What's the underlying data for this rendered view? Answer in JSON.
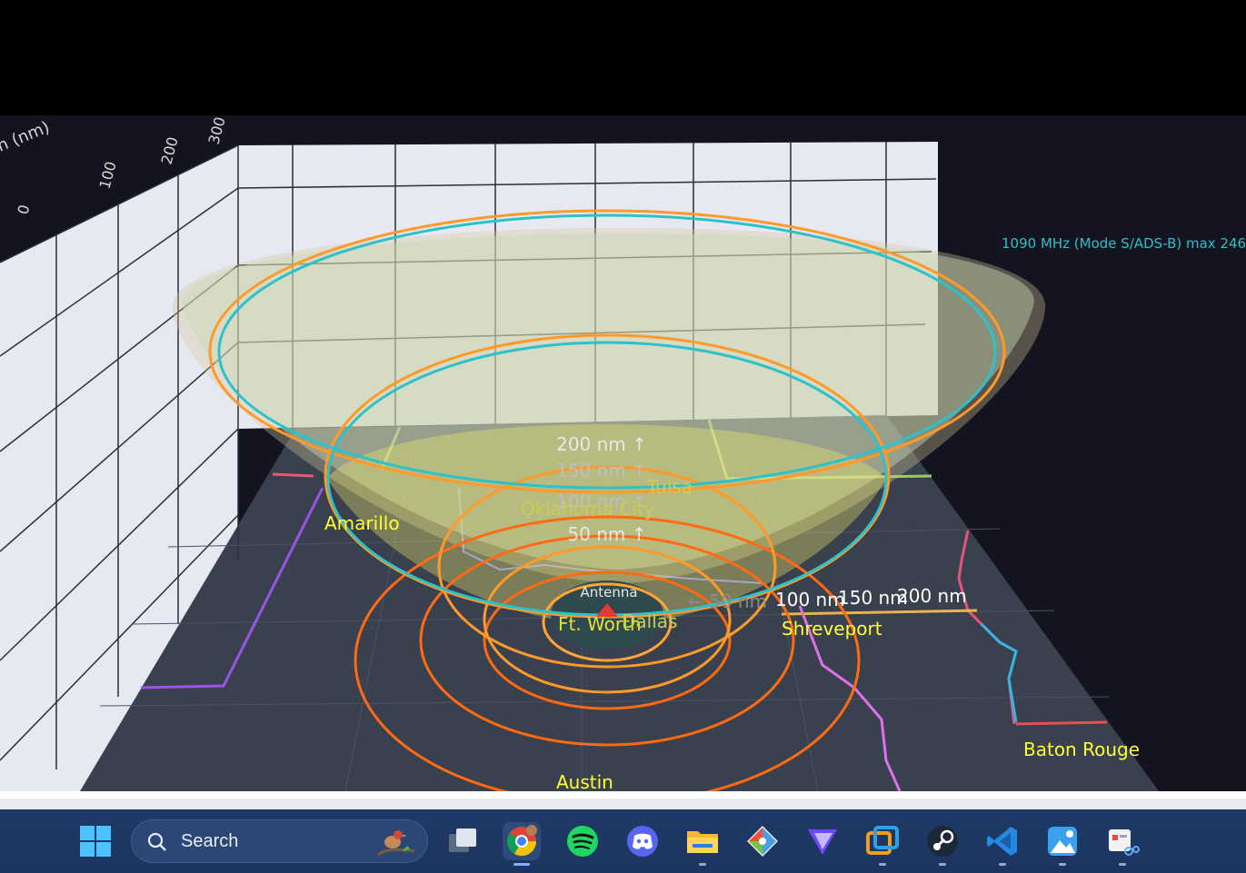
{
  "plot": {
    "axis_title": "n (nm)",
    "axis_ticks": [
      "0",
      "100",
      "200",
      "300"
    ],
    "legend_text": "1090 MHz (Mode S/ADS-B) max 246",
    "antenna_label": "Antenna",
    "range_labels_vertical": [
      "200 nm ↑",
      "150 nm ↑",
      "100 nm ↑",
      "50 nm ↑"
    ],
    "range_labels_horizontal": [
      "← 50 nm",
      "100 nm",
      "150 nm",
      "200 nm"
    ],
    "cities": {
      "amarillo": "Amarillo",
      "oklahoma_city": "Oklahoma City",
      "tulsa": "Tulsa",
      "ft_worth": "Ft. Worth",
      "dallas": "Dallas",
      "shreveport": "Shreveport",
      "baton_rouge": "Baton Rouge",
      "austin": "Austin"
    },
    "colors": {
      "range_ring": "#ff7a1a",
      "coverage_ring": "#2fc1c8",
      "city_label": "#ffff33",
      "legend": "#2fc1c8"
    }
  },
  "taskbar": {
    "search_placeholder": "Search",
    "apps": [
      {
        "name": "start-icon"
      },
      {
        "name": "task-view-icon"
      },
      {
        "name": "chrome-icon"
      },
      {
        "name": "spotify-icon"
      },
      {
        "name": "discord-icon"
      },
      {
        "name": "file-explorer-icon"
      },
      {
        "name": "git-icon"
      },
      {
        "name": "vpn-icon"
      },
      {
        "name": "remote-desktop-icon"
      },
      {
        "name": "steam-icon"
      },
      {
        "name": "vscode-icon"
      },
      {
        "name": "photos-icon"
      },
      {
        "name": "snipping-tool-icon"
      }
    ]
  }
}
